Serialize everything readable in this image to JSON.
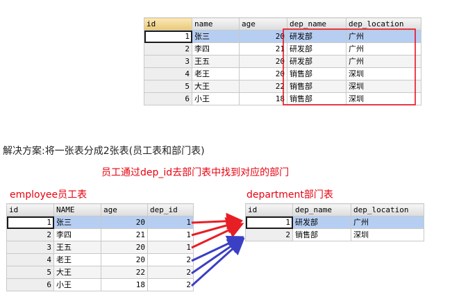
{
  "top_table": {
    "headers": [
      "id",
      "name",
      "age",
      "dep_name",
      "dep_location"
    ],
    "rows": [
      [
        "1",
        "张三",
        "20",
        "研发部",
        "广州"
      ],
      [
        "2",
        "李四",
        "21",
        "研发部",
        "广州"
      ],
      [
        "3",
        "王五",
        "20",
        "研发部",
        "广州"
      ],
      [
        "4",
        "老王",
        "20",
        "销售部",
        "深圳"
      ],
      [
        "5",
        "大王",
        "22",
        "销售部",
        "深圳"
      ],
      [
        "6",
        "小王",
        "18",
        "销售部",
        "深圳"
      ]
    ]
  },
  "solution_text": "解决方案:将一张表分成2张表(员工表和部门表)",
  "link_text": "员工通过dep_id去部门表中找到对应的部门",
  "employee_label": "employee员工表",
  "department_label": "department部门表",
  "employee_table": {
    "headers": [
      "id",
      "NAME",
      "age",
      "dep_id"
    ],
    "rows": [
      [
        "1",
        "张三",
        "20",
        "1"
      ],
      [
        "2",
        "李四",
        "21",
        "1"
      ],
      [
        "3",
        "王五",
        "20",
        "1"
      ],
      [
        "4",
        "老王",
        "20",
        "2"
      ],
      [
        "5",
        "大王",
        "22",
        "2"
      ],
      [
        "6",
        "小王",
        "18",
        "2"
      ]
    ]
  },
  "department_table": {
    "headers": [
      "id",
      "dep_name",
      "dep_location"
    ],
    "rows": [
      [
        "1",
        "研发部",
        "广州"
      ],
      [
        "2",
        "销售部",
        "深圳"
      ]
    ]
  },
  "colors": {
    "highlight_box": "#e8000e",
    "arrow_red": "#e81e25",
    "arrow_blue": "#3b3fc4",
    "selected_row": "#b6cef2"
  }
}
